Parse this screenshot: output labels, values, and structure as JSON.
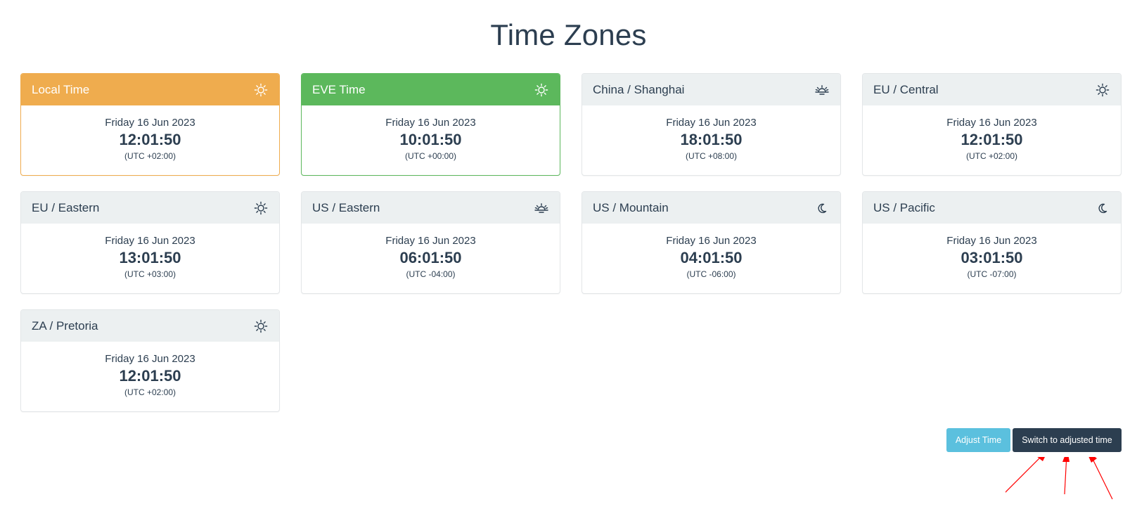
{
  "page": {
    "title": "Time Zones"
  },
  "cards": [
    {
      "title": "Local Time",
      "date": "Friday 16 Jun 2023",
      "time": "12:01:50",
      "offset": "(UTC +02:00)",
      "icon": "sun-icon",
      "style": "local",
      "accent": "#efac4e"
    },
    {
      "title": "EVE Time",
      "date": "Friday 16 Jun 2023",
      "time": "10:01:50",
      "offset": "(UTC +00:00)",
      "icon": "sun-icon",
      "style": "eve",
      "accent": "#5cb85c"
    },
    {
      "title": "China / Shanghai",
      "date": "Friday 16 Jun 2023",
      "time": "18:01:50",
      "offset": "(UTC +08:00)",
      "icon": "sunset-icon",
      "style": "default"
    },
    {
      "title": "EU / Central",
      "date": "Friday 16 Jun 2023",
      "time": "12:01:50",
      "offset": "(UTC +02:00)",
      "icon": "sun-icon",
      "style": "default"
    },
    {
      "title": "EU / Eastern",
      "date": "Friday 16 Jun 2023",
      "time": "13:01:50",
      "offset": "(UTC +03:00)",
      "icon": "sun-icon",
      "style": "default"
    },
    {
      "title": "US / Eastern",
      "date": "Friday 16 Jun 2023",
      "time": "06:01:50",
      "offset": "(UTC -04:00)",
      "icon": "sunrise-icon",
      "style": "default"
    },
    {
      "title": "US / Mountain",
      "date": "Friday 16 Jun 2023",
      "time": "04:01:50",
      "offset": "(UTC -06:00)",
      "icon": "moon-icon",
      "style": "default"
    },
    {
      "title": "US / Pacific",
      "date": "Friday 16 Jun 2023",
      "time": "03:01:50",
      "offset": "(UTC -07:00)",
      "icon": "moon-icon",
      "style": "default"
    },
    {
      "title": "ZA / Pretoria",
      "date": "Friday 16 Jun 2023",
      "time": "12:01:50",
      "offset": "(UTC +02:00)",
      "icon": "sun-icon",
      "style": "default"
    }
  ],
  "actions": {
    "adjust_label": "Adjust Time",
    "switch_label": "Switch to adjusted time"
  },
  "colors": {
    "text": "#2c3e50",
    "header_bg": "#ecf0f1",
    "adjust_button": "#5bc0de",
    "switch_button": "#2c3e50",
    "annotation_arrows": "#ff0000"
  }
}
